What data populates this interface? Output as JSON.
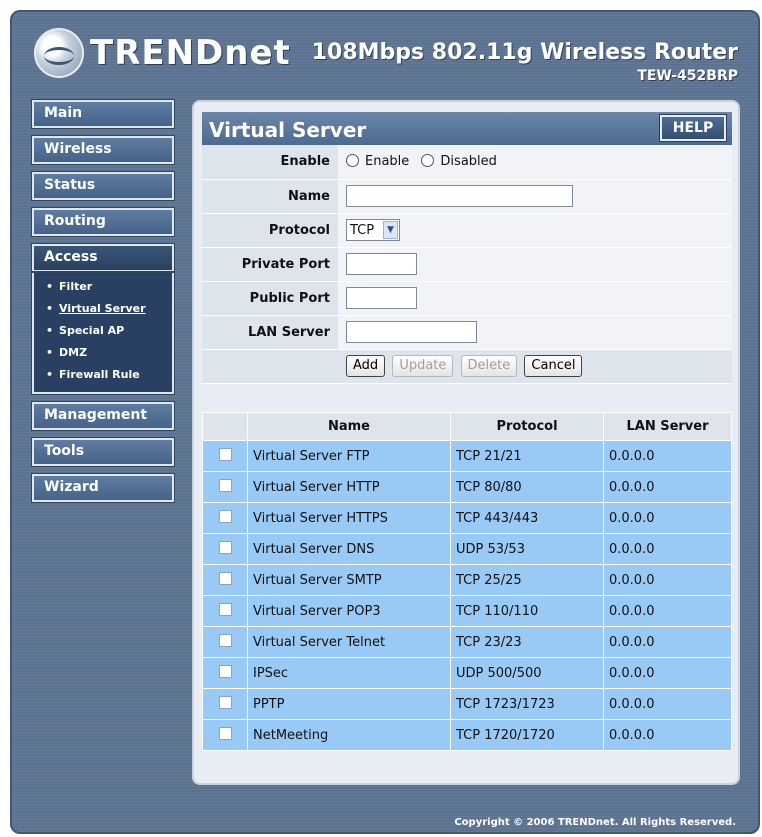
{
  "header": {
    "brand": "TRENDnet",
    "product": "108Mbps 802.11g Wireless Router",
    "model": "TEW-452BRP"
  },
  "sidebar": {
    "items": [
      {
        "label": "Main"
      },
      {
        "label": "Wireless"
      },
      {
        "label": "Status"
      },
      {
        "label": "Routing"
      },
      {
        "label": "Access"
      },
      {
        "label": "Management"
      },
      {
        "label": "Tools"
      },
      {
        "label": "Wizard"
      }
    ],
    "access_submenu": [
      {
        "label": "Filter"
      },
      {
        "label": "Virtual Server"
      },
      {
        "label": "Special AP"
      },
      {
        "label": "DMZ"
      },
      {
        "label": "Firewall Rule"
      }
    ]
  },
  "page": {
    "title": "Virtual Server",
    "help_label": "HELP"
  },
  "form": {
    "enable_label": "Enable",
    "enable_option": "Enable",
    "disabled_option": "Disabled",
    "name_label": "Name",
    "name_value": "",
    "protocol_label": "Protocol",
    "protocol_value": "TCP",
    "private_port_label": "Private Port",
    "private_port_value": "",
    "public_port_label": "Public Port",
    "public_port_value": "",
    "lan_server_label": "LAN Server",
    "lan_server_value": "",
    "buttons": {
      "add": "Add",
      "update": "Update",
      "delete": "Delete",
      "cancel": "Cancel"
    }
  },
  "table": {
    "headers": [
      "Name",
      "Protocol",
      "LAN Server"
    ],
    "rows": [
      {
        "name": "Virtual Server FTP",
        "protocol": "TCP 21/21",
        "lan": "0.0.0.0"
      },
      {
        "name": "Virtual Server HTTP",
        "protocol": "TCP 80/80",
        "lan": "0.0.0.0"
      },
      {
        "name": "Virtual Server HTTPS",
        "protocol": "TCP 443/443",
        "lan": "0.0.0.0"
      },
      {
        "name": "Virtual Server DNS",
        "protocol": "UDP 53/53",
        "lan": "0.0.0.0"
      },
      {
        "name": "Virtual Server SMTP",
        "protocol": "TCP 25/25",
        "lan": "0.0.0.0"
      },
      {
        "name": "Virtual Server POP3",
        "protocol": "TCP 110/110",
        "lan": "0.0.0.0"
      },
      {
        "name": "Virtual Server Telnet",
        "protocol": "TCP 23/23",
        "lan": "0.0.0.0"
      },
      {
        "name": "IPSec",
        "protocol": "UDP 500/500",
        "lan": "0.0.0.0"
      },
      {
        "name": "PPTP",
        "protocol": "TCP 1723/1723",
        "lan": "0.0.0.0"
      },
      {
        "name": "NetMeeting",
        "protocol": "TCP 1720/1720",
        "lan": "0.0.0.0"
      }
    ]
  },
  "footer": {
    "copyright": "Copyright © 2006 TRENDnet. All Rights Reserved."
  },
  "colors": {
    "frame": "#5b7290",
    "row_blue": "#99c9f5",
    "nav_active": "#294062"
  }
}
